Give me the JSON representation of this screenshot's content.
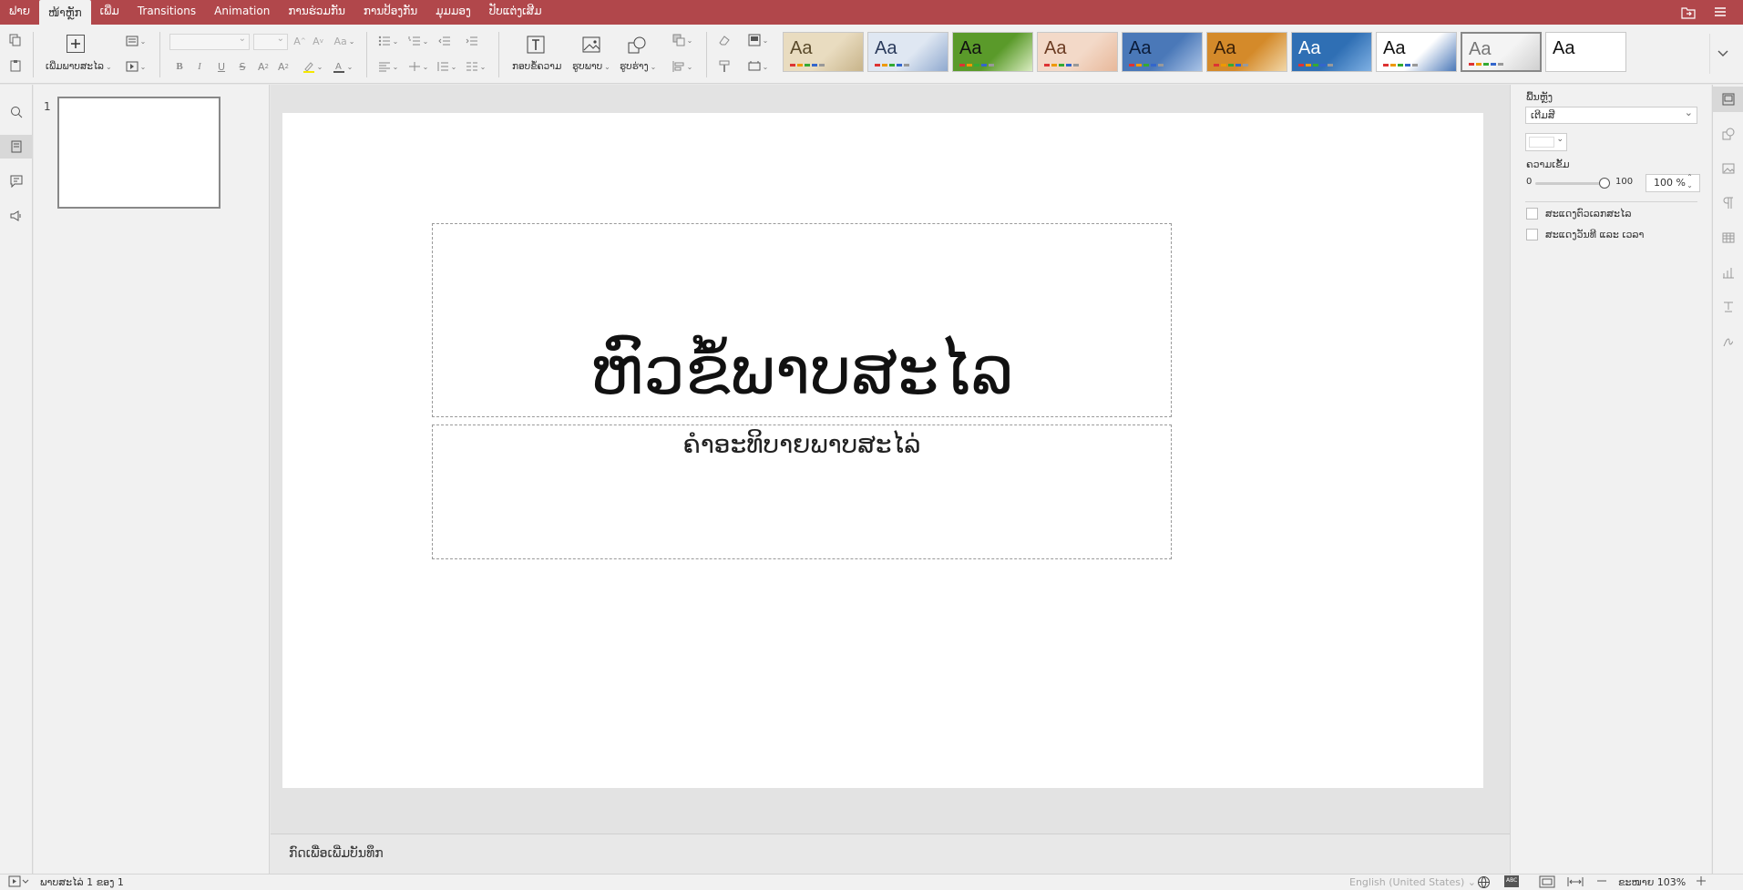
{
  "menu": {
    "tabs": [
      "ຟາຍ",
      "ໜ້າຫຼັກ",
      "ເພີ່ມ",
      "Transitions",
      "Animation",
      "ການຮ່ວມກັນ",
      "ການປ້ອງກັນ",
      "ມຸມມອງ",
      "ປັບແຕ່ງເສີມ"
    ],
    "active_index": 1
  },
  "toolbar": {
    "add_slide_label": "ເພີ່ມພາບສະໄລ",
    "text_box_label": "ກອບຂໍ້ຄວາມ",
    "picture_label": "ຮູບພາບ",
    "shape_label": "ຮູບຮ່າງ"
  },
  "themes": [
    {
      "bg": "#e9dcc0",
      "fg": "#5a4a2a",
      "accent": "#c8b48a"
    },
    {
      "bg": "#dfe7f2",
      "fg": "#2b3b5c",
      "accent": "#8fa9cf"
    },
    {
      "bg": "#5a9a2a",
      "fg": "#111",
      "accent": "#d9ecc0"
    },
    {
      "bg": "#f3d9c8",
      "fg": "#6b3b22",
      "accent": "#e8b89a"
    },
    {
      "bg": "#4a78b8",
      "fg": "#0b1c3a",
      "accent": "#aac3e6"
    },
    {
      "bg": "#d48a2a",
      "fg": "#3a2008",
      "accent": "#f1d7a8"
    },
    {
      "bg": "#2f6fb4",
      "fg": "#fff",
      "accent": "#7fb0e3"
    },
    {
      "bg": "#ffffff",
      "fg": "#111",
      "accent": "#4a78b8"
    },
    {
      "bg": "#f4f4f4",
      "fg": "#777",
      "accent": "#d0d0d0"
    },
    {
      "bg": "#ffffff",
      "fg": "#111",
      "accent": "#ffffff"
    }
  ],
  "theme_text": "Aa",
  "slides_panel": {
    "slide_number": "1"
  },
  "slide": {
    "title": "ຫົວຂໍ້ພາບສະໄລ",
    "subtitle": "ຄຳອະທິບາຍພາບສະໄລ່"
  },
  "notes": {
    "placeholder": "ກົດເພື່ອເພີ່ມບັນທຶກ"
  },
  "settings": {
    "fill_label": "ພື້ນຫຼັງ",
    "fill_value": "ເຕີມສີ",
    "opacity_label": "ຄວາມເຂັ້ມ",
    "slider_min": "0",
    "slider_max": "100",
    "opacity_value": "100 %",
    "opacity_level": 100,
    "checkbox1_label": "ສະແດງຕົວເລກສະໄລ",
    "checkbox2_label": "ສະແດງວັນທີ ແລະ ເວລາ"
  },
  "status": {
    "slide_info": "ພາບສະໄລ່ 1 ຂອງ 1",
    "language": "English (United States)",
    "zoom": "ຂະໜາຍ 103%"
  }
}
